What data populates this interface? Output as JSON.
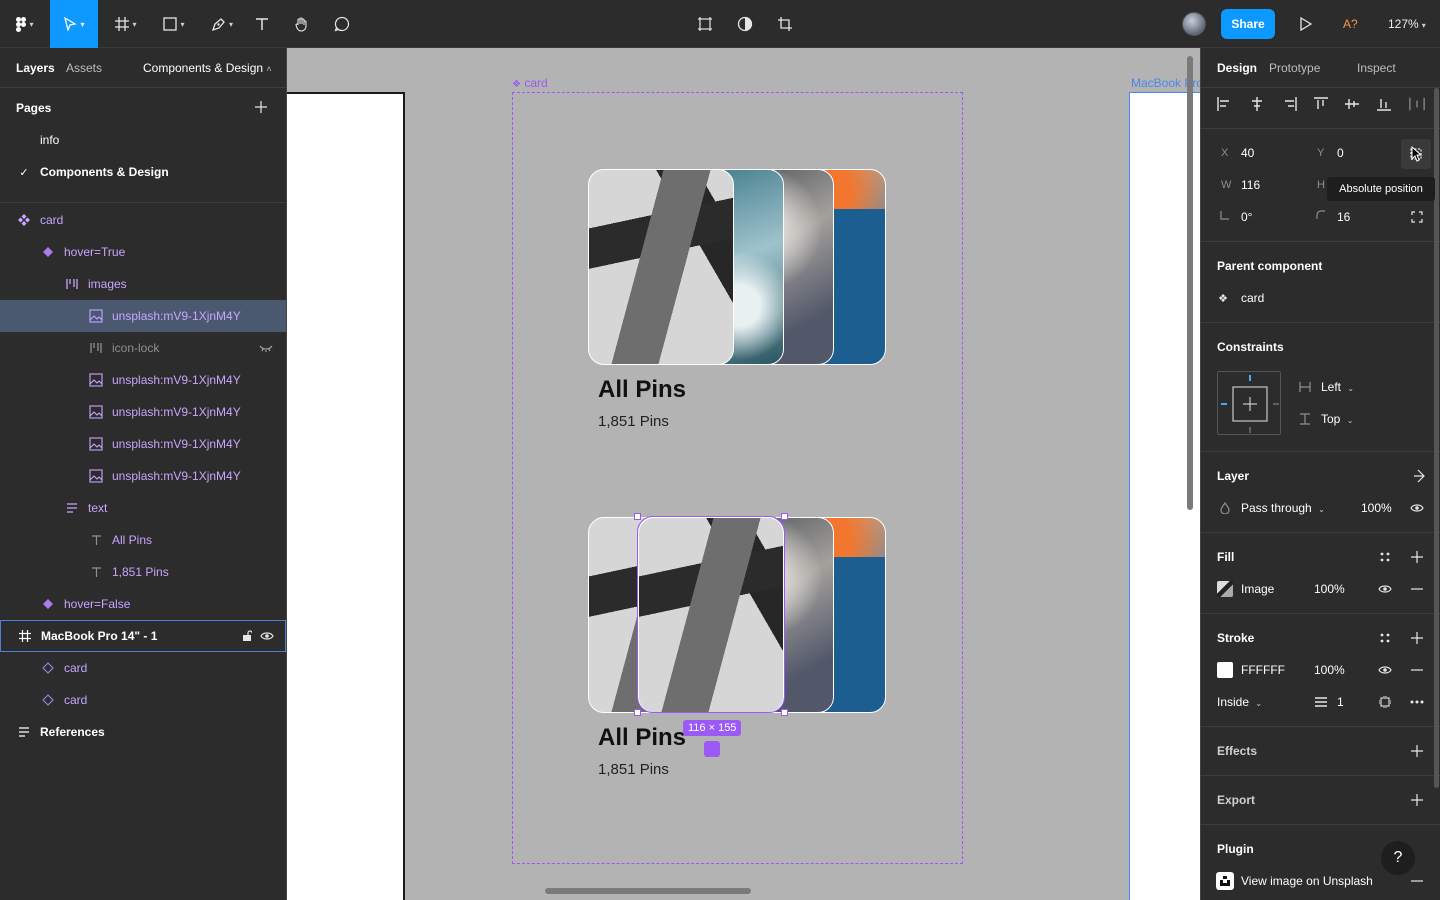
{
  "toolbar": {
    "share_label": "Share",
    "accessibility_label": "A?",
    "zoom_label": "127%"
  },
  "left": {
    "tabs": {
      "layers": "Layers",
      "assets": "Assets",
      "page": "Components & Design"
    },
    "pages_title": "Pages",
    "pages": [
      "info",
      "Components & Design"
    ],
    "layers": [
      {
        "label": "card",
        "indent": 0,
        "icon": "component-icon"
      },
      {
        "label": "hover=True",
        "indent": 1,
        "icon": "variant-icon"
      },
      {
        "label": "images",
        "indent": 2,
        "icon": "autolayout-icon"
      },
      {
        "label": "unsplash:mV9-1XjnM4Y",
        "indent": 3,
        "icon": "image-icon",
        "selected": true
      },
      {
        "label": "icon-lock",
        "indent": 3,
        "icon": "autolayout-icon",
        "hidden": true
      },
      {
        "label": "unsplash:mV9-1XjnM4Y",
        "indent": 3,
        "icon": "image-icon"
      },
      {
        "label": "unsplash:mV9-1XjnM4Y",
        "indent": 3,
        "icon": "image-icon"
      },
      {
        "label": "unsplash:mV9-1XjnM4Y",
        "indent": 3,
        "icon": "image-icon"
      },
      {
        "label": "unsplash:mV9-1XjnM4Y",
        "indent": 3,
        "icon": "image-icon"
      },
      {
        "label": "text",
        "indent": 2,
        "icon": "text-stack-icon"
      },
      {
        "label": "All Pins",
        "indent": 3,
        "icon": "text-icon"
      },
      {
        "label": "1,851 Pins",
        "indent": 3,
        "icon": "text-icon"
      },
      {
        "label": "hover=False",
        "indent": 1,
        "icon": "variant-icon"
      },
      {
        "label": "MacBook Pro 14\" - 1",
        "indent": 0,
        "icon": "frame-icon",
        "outlined": true
      },
      {
        "label": "card",
        "indent": 1,
        "icon": "instance-icon"
      },
      {
        "label": "card",
        "indent": 1,
        "icon": "instance-icon"
      },
      {
        "label": "References",
        "indent": 0,
        "icon": "section-icon"
      }
    ]
  },
  "canvas": {
    "card_frame_label": "card",
    "mbp_frame_label": "MacBook Pro",
    "card_title": "All Pins",
    "card_sub": "1,851 Pins",
    "size_badge": "116 × 155"
  },
  "right": {
    "tabs": {
      "design": "Design",
      "prototype": "Prototype",
      "inspect": "Inspect"
    },
    "x_label": "X",
    "x_value": "40",
    "y_label": "Y",
    "y_value": "0",
    "w_label": "W",
    "w_value": "116",
    "h_label": "H",
    "rotation": "0°",
    "radius": "16",
    "tooltip": "Absolute position",
    "parent_component_title": "Parent component",
    "parent_component": "card",
    "constraints_title": "Constraints",
    "constraint_h": "Left",
    "constraint_v": "Top",
    "layer_title": "Layer",
    "blend_mode": "Pass through",
    "layer_opacity": "100%",
    "fill_title": "Fill",
    "fill_type": "Image",
    "fill_opacity": "100%",
    "stroke_title": "Stroke",
    "stroke_color": "FFFFFF",
    "stroke_opacity": "100%",
    "stroke_position": "Inside",
    "stroke_weight": "1",
    "effects_title": "Effects",
    "export_title": "Export",
    "plugin_title": "Plugin",
    "plugin_action": "View image on Unsplash",
    "help_label": "?"
  },
  "colors": {
    "accent": "#0d99ff",
    "component": "#9b59f6",
    "frame": "#4a86f0"
  }
}
